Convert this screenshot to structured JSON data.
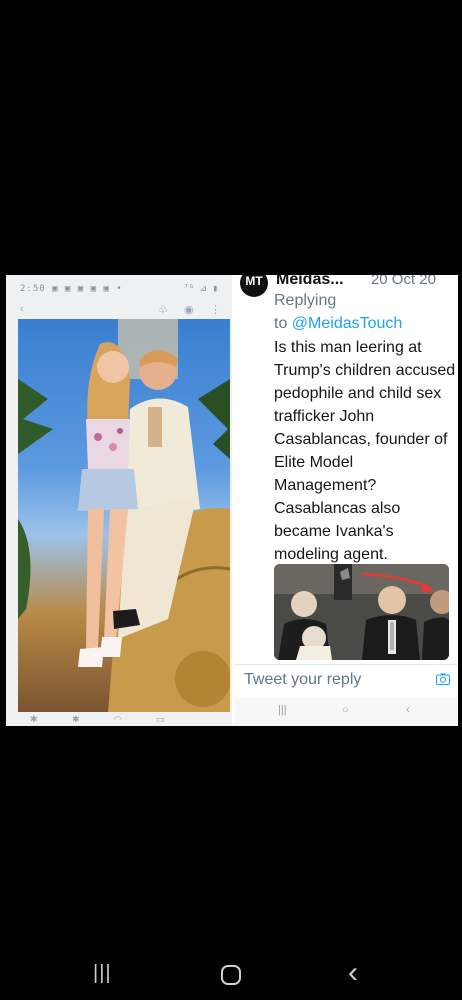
{
  "left_panel": {
    "status_time": "2:50 ▣ ▣ ▣ ▣ ▣ •",
    "status_signal": "⁷ᴳ ⊿ ▮",
    "toolbar_icons": [
      "back-icon",
      "hands-icon",
      "eye-icon",
      "more-icon"
    ],
    "nav_icons": [
      "nav-icon-1",
      "nav-icon-2",
      "nav-icon-3",
      "nav-icon-4"
    ]
  },
  "tweet": {
    "avatar_text": "MT",
    "author": "Meidas...",
    "date": "20 Oct 20",
    "replying_label": "Replying",
    "to_label": "to",
    "mention": "@MeidasTouch",
    "text": "Is this man leering at Trump's children accused pedophile and child sex trafficker John Casablancas, founder of Elite Model Management? Casablancas also became Ivanka's modeling agent.",
    "reply_placeholder": "Tweet your reply",
    "nav_recent": "|||",
    "nav_home": "○",
    "nav_back": "‹"
  },
  "system_nav": {
    "recent": "|||",
    "home": "○",
    "back": "‹"
  },
  "colors": {
    "link": "#1da1f2",
    "muted": "#657786",
    "arrow": "#e53935"
  }
}
